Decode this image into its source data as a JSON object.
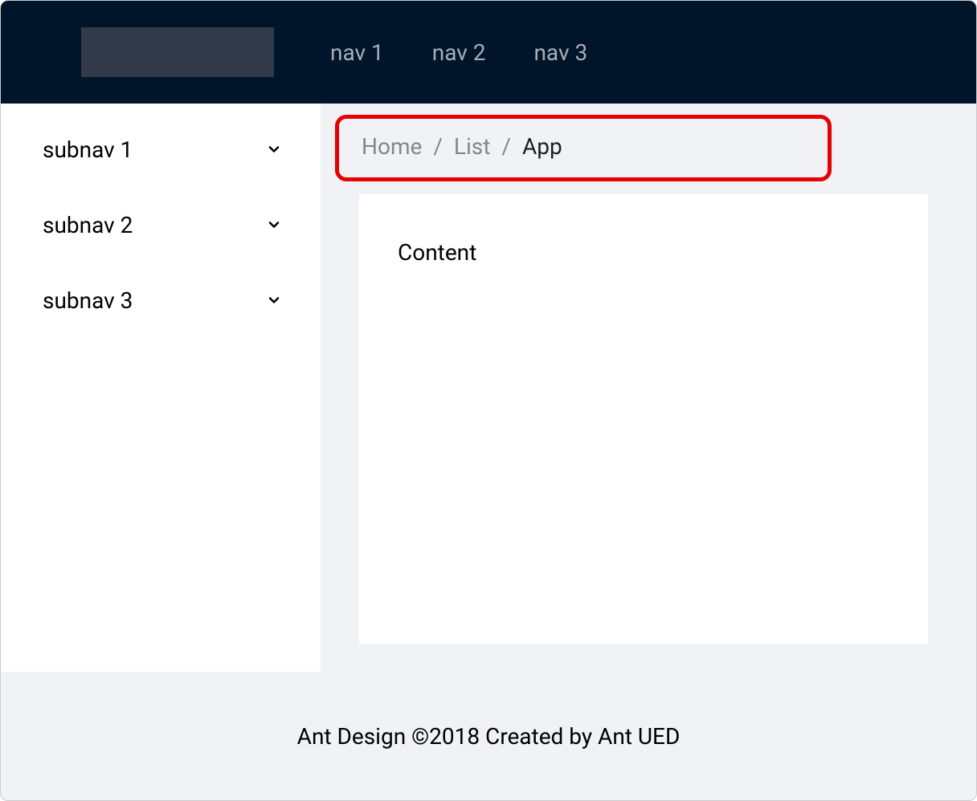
{
  "header": {
    "nav_items": [
      {
        "label": "nav 1"
      },
      {
        "label": "nav 2"
      },
      {
        "label": "nav 3"
      }
    ]
  },
  "sidebar": {
    "items": [
      {
        "label": "subnav 1"
      },
      {
        "label": "subnav 2"
      },
      {
        "label": "subnav 3"
      }
    ]
  },
  "breadcrumb": {
    "items": [
      {
        "label": "Home",
        "current": false
      },
      {
        "label": "List",
        "current": false
      },
      {
        "label": "App",
        "current": true
      }
    ],
    "separator": "/"
  },
  "content": {
    "text": "Content"
  },
  "footer": {
    "text": "Ant Design ©2018 Created by Ant UED"
  }
}
